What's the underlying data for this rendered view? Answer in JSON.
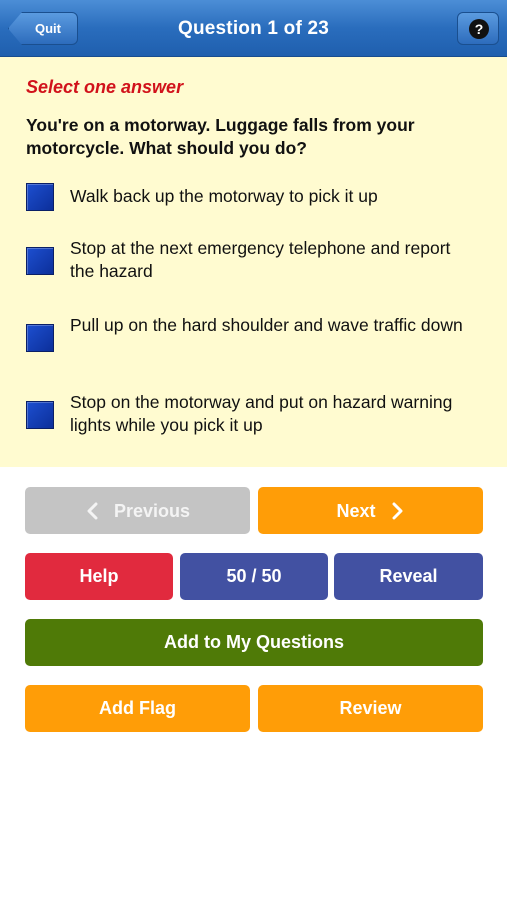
{
  "navbar": {
    "quit_label": "Quit",
    "title": "Question 1 of 23",
    "help_glyph": "?"
  },
  "question": {
    "instruction": "Select one answer",
    "text": "You're on a motorway. Luggage falls from your motorcycle. What should you do?",
    "answers": [
      {
        "text": "Walk back up the motorway to pick it up"
      },
      {
        "text": "Stop at the next emergency telephone and report the hazard"
      },
      {
        "text": "Pull up on the hard shoulder and wave traffic down"
      },
      {
        "text": "Stop on the motorway and put on hazard warning lights while you pick it up"
      }
    ]
  },
  "buttons": {
    "previous": "Previous",
    "next": "Next",
    "help": "Help",
    "fifty_fifty": "50 / 50",
    "reveal": "Reveal",
    "add_to_my_questions": "Add to My Questions",
    "add_flag": "Add Flag",
    "review": "Review"
  },
  "icons": {
    "previous": "chevron-left-icon",
    "next": "chevron-right-icon",
    "help": "question-circle-icon",
    "checkbox": "checkbox-icon"
  },
  "colors": {
    "navbar": "#2a6dbd",
    "question_background": "#fffbd0",
    "instruction": "#d1121b",
    "checkbox": "#1d4fd0",
    "previous": "#c4c4c4",
    "orange": "#ff9d07",
    "help": "#e12a3e",
    "purple": "#4251a2",
    "green": "#4f7a07"
  }
}
